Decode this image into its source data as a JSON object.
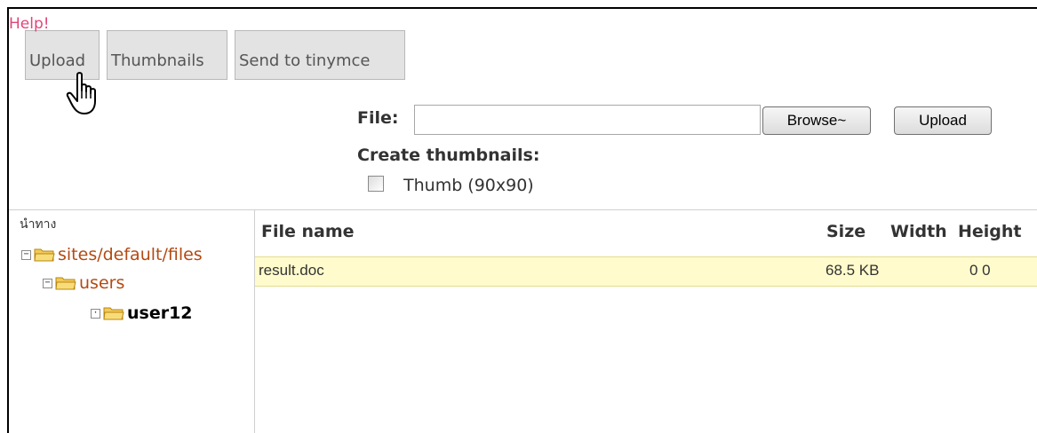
{
  "help": "Help!",
  "tabs": [
    {
      "label": "Upload"
    },
    {
      "label": "Thumbnails"
    },
    {
      "label": "Send to tinymce"
    }
  ],
  "upload_form": {
    "file_label": "File:",
    "file_value": "",
    "browse_label": "Browse~",
    "upload_label": "Upload",
    "thumbnails_label": "Create thumbnails:",
    "thumb_option": "Thumb (90x90)",
    "thumb_checked": false
  },
  "tree": {
    "caption": "นำทาง",
    "nodes": [
      {
        "label": "sites/default/files",
        "toggle": "−"
      },
      {
        "label": "users",
        "toggle": "−"
      },
      {
        "label": "user12",
        "toggle": "·"
      }
    ]
  },
  "file_table": {
    "headers": [
      "File name",
      "Size",
      "Width",
      "Height"
    ],
    "rows": [
      {
        "name": "result.doc",
        "size": "68.5 KB",
        "dims": "0 0"
      }
    ]
  },
  "colors": {
    "help": "#e0457b",
    "folder_label": "#b34a12",
    "selected_row": "#fffbcc"
  }
}
